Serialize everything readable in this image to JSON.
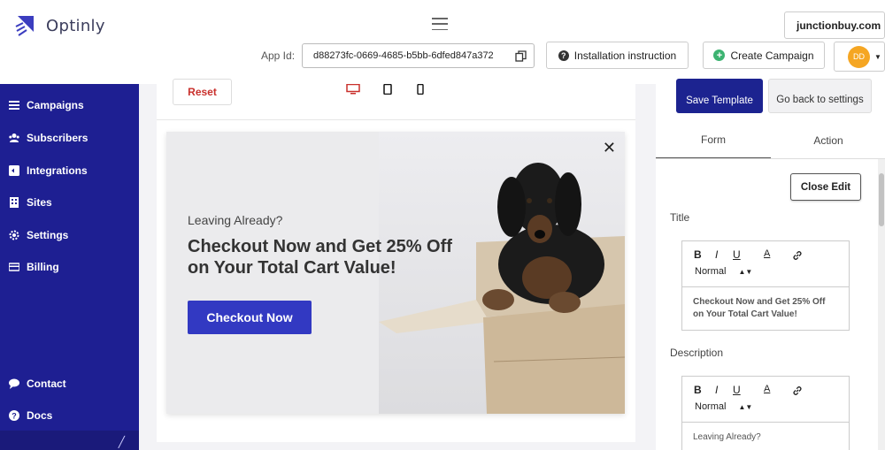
{
  "app": {
    "name": "Optinly"
  },
  "header": {
    "site_selector": "junctionbuy.com",
    "app_id_label": "App Id:",
    "app_id_value": "d88273fc-0669-4685-b5bb-6dfed847a372",
    "install_label": "Installation instruction",
    "create_label": "Create Campaign",
    "avatar_initials": "DD"
  },
  "sidebar": {
    "items": [
      {
        "label": "Campaigns",
        "icon": "list-icon"
      },
      {
        "label": "Subscribers",
        "icon": "users-icon"
      },
      {
        "label": "Integrations",
        "icon": "integrations-icon"
      },
      {
        "label": "Sites",
        "icon": "sites-icon"
      },
      {
        "label": "Settings",
        "icon": "gear-icon"
      },
      {
        "label": "Billing",
        "icon": "card-icon"
      }
    ],
    "footer_items": [
      {
        "label": "Contact",
        "icon": "chat-icon"
      },
      {
        "label": "Docs",
        "icon": "help-icon"
      }
    ]
  },
  "editor": {
    "reset_label": "Reset",
    "devices": [
      "desktop-icon",
      "tablet-icon",
      "mobile-icon"
    ],
    "popup": {
      "subtitle": "Leaving Already?",
      "title": "Checkout Now and Get 25% Off on Your Total Cart Value!",
      "cta": "Checkout Now",
      "close": "✕"
    }
  },
  "panel": {
    "save_label": "Save Template",
    "back_label": "Go back to settings",
    "tabs": [
      "Form",
      "Action"
    ],
    "close_edit_label": "Close Edit",
    "title_label": "Title",
    "title_content": "Checkout Now and Get 25% Off on Your Total Cart Value!",
    "description_label": "Description",
    "description_content": "Leaving Already?",
    "format_select": "Normal",
    "toolbar_buttons": [
      "B",
      "I",
      "U",
      "A"
    ]
  },
  "colors": {
    "sidebar": "#1e1f92",
    "primary": "#3239c2",
    "save": "#1c2390",
    "reset": "#c9302c",
    "avatar": "#f5a623",
    "create_icon": "#3cb371"
  }
}
